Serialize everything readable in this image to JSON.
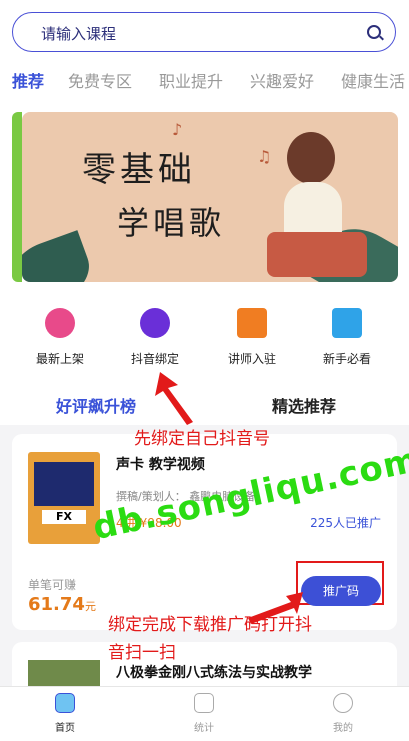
{
  "search": {
    "placeholder": "请输入课程"
  },
  "tabs": [
    "推荐",
    "免费专区",
    "职业提升",
    "兴趣爱好",
    "健康生活"
  ],
  "banner": {
    "line1": "零基础",
    "line2": "学唱歌"
  },
  "quick_icons": [
    {
      "label": "最新上架",
      "icon": "new-badge-icon",
      "color": "#e84a8a"
    },
    {
      "label": "抖音绑定",
      "icon": "tiktok-icon",
      "color": "#6a2fd8"
    },
    {
      "label": "讲师入驻",
      "icon": "bookmark-plus-icon",
      "color": "#f07d22"
    },
    {
      "label": "新手必看",
      "icon": "book-icon",
      "color": "#2fa3e8"
    }
  ],
  "sections": {
    "left": "好评飙升榜",
    "right": "精选推荐"
  },
  "course": {
    "title": "声卡 教学视频",
    "author": "撰稿/策划人： 鑫鹏电脑设备",
    "price": "4讲/¥98.00",
    "promoted": "225人已推广",
    "earn_label": "单笔可赚",
    "earn_value": "61.74",
    "earn_unit": "元",
    "promo_button": "推广码"
  },
  "course2": {
    "title": "八极拳金刚八式练法与实战教学"
  },
  "bottom_nav": [
    {
      "label": "首页",
      "icon": "home-icon"
    },
    {
      "label": "统计",
      "icon": "stats-icon"
    },
    {
      "label": "我的",
      "icon": "profile-icon"
    }
  ],
  "annotations": {
    "a1": "先绑定自己抖音号",
    "a2_line1": "绑定完成下载推广码打开抖",
    "a2_line2": "音扫一扫"
  },
  "watermark": "db.songliqu.com"
}
